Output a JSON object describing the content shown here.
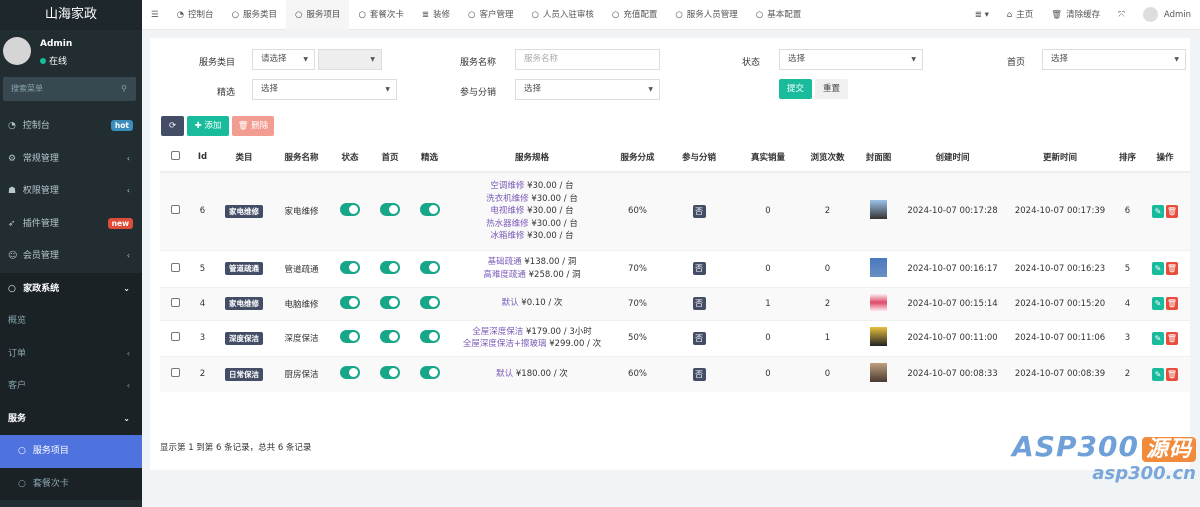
{
  "sidebar": {
    "brand": "山海家政",
    "user": {
      "name": "Admin",
      "status": "在线"
    },
    "search_placeholder": "搜索菜单",
    "items": [
      {
        "label": "控制台",
        "icon": "dashboard-icon",
        "badge": "hot",
        "badge_color": "#3c8dbc"
      },
      {
        "label": "常规管理",
        "icon": "cogs-icon"
      },
      {
        "label": "权限管理",
        "icon": "group-icon"
      },
      {
        "label": "插件管理",
        "icon": "rocket-icon",
        "badge": "new",
        "badge_color": "#dd4b39"
      },
      {
        "label": "会员管理",
        "icon": "user-circle-icon"
      },
      {
        "label": "家政系统",
        "icon": "circle-icon"
      },
      {
        "label": "概览"
      },
      {
        "label": "订单"
      },
      {
        "label": "客户"
      },
      {
        "label": "服务"
      },
      {
        "label": "服务项目",
        "icon": "circle-icon"
      },
      {
        "label": "套餐次卡",
        "icon": "circle-icon"
      }
    ]
  },
  "topnav": {
    "tabs": [
      "控制台",
      "服务类目",
      "服务项目",
      "套餐次卡",
      "装修",
      "客户管理",
      "人员入驻审核",
      "充值配置",
      "服务人员管理",
      "基本配置"
    ],
    "home": "主页",
    "clear_cache": "清除缓存",
    "user": "Admin"
  },
  "filters": {
    "category_label": "服务类目",
    "category_value": "请选择",
    "name_label": "服务名称",
    "name_placeholder": "服务名称",
    "status_label": "状态",
    "status_value": "选择",
    "home_label": "首页",
    "home_value": "选择",
    "featured_label": "精选",
    "featured_value": "选择",
    "dist_label": "参与分销",
    "dist_value": "选择",
    "submit": "提交",
    "reset": "重置"
  },
  "toolbar": {
    "add": "添加",
    "delete": "删除"
  },
  "table": {
    "headers": [
      "Id",
      "类目",
      "服务名称",
      "状态",
      "首页",
      "精选",
      "服务规格",
      "服务分成",
      "参与分销",
      "真实销量",
      "浏览次数",
      "封面图",
      "创建时间",
      "更新时间",
      "排序",
      "操作"
    ],
    "rows": [
      {
        "id": "6",
        "category": "家电维修",
        "name": "家电维修",
        "specs": [
          [
            "空调维修",
            "¥30.00 / 台"
          ],
          [
            "洗衣机维修",
            "¥30.00 / 台"
          ],
          [
            "电视维修",
            "¥30.00 / 台"
          ],
          [
            "热水器维修",
            "¥30.00 / 台"
          ],
          [
            "冰箱维修",
            "¥30.00 / 台"
          ]
        ],
        "share": "60%",
        "dist": "否",
        "sales": "0",
        "views": "2",
        "created": "2024-10-07 00:17:28",
        "updated": "2024-10-07 00:17:39",
        "sort": "6"
      },
      {
        "id": "5",
        "category": "管道疏通",
        "name": "管道疏通",
        "specs": [
          [
            "基础疏通",
            "¥138.00 / 洞"
          ],
          [
            "高难度疏通",
            "¥258.00 / 洞"
          ]
        ],
        "share": "70%",
        "dist": "否",
        "sales": "0",
        "views": "0",
        "created": "2024-10-07 00:16:17",
        "updated": "2024-10-07 00:16:23",
        "sort": "5"
      },
      {
        "id": "4",
        "category": "家电维修",
        "name": "电脑维修",
        "specs": [
          [
            "默认",
            "¥0.10 / 次"
          ]
        ],
        "share": "70%",
        "dist": "否",
        "sales": "1",
        "views": "2",
        "created": "2024-10-07 00:15:14",
        "updated": "2024-10-07 00:15:20",
        "sort": "4"
      },
      {
        "id": "3",
        "category": "深度保洁",
        "name": "深度保洁",
        "specs": [
          [
            "全屋深度保洁",
            "¥179.00 / 3小时"
          ],
          [
            "全屋深度保洁+擦玻璃",
            "¥299.00 / 次"
          ]
        ],
        "share": "50%",
        "dist": "否",
        "sales": "0",
        "views": "1",
        "created": "2024-10-07 00:11:00",
        "updated": "2024-10-07 00:11:06",
        "sort": "3"
      },
      {
        "id": "2",
        "category": "日常保洁",
        "name": "厨房保洁",
        "specs": [
          [
            "默认",
            "¥180.00 / 次"
          ]
        ],
        "share": "60%",
        "dist": "否",
        "sales": "0",
        "views": "0",
        "created": "2024-10-07 00:08:33",
        "updated": "2024-10-07 00:08:39",
        "sort": "2"
      }
    ]
  },
  "pagination_text": "显示第 1 到第 6 条记录，总共 6 条记录",
  "watermark": {
    "brand": "ASP300",
    "tag": "源码",
    "url": "asp300.cn"
  }
}
